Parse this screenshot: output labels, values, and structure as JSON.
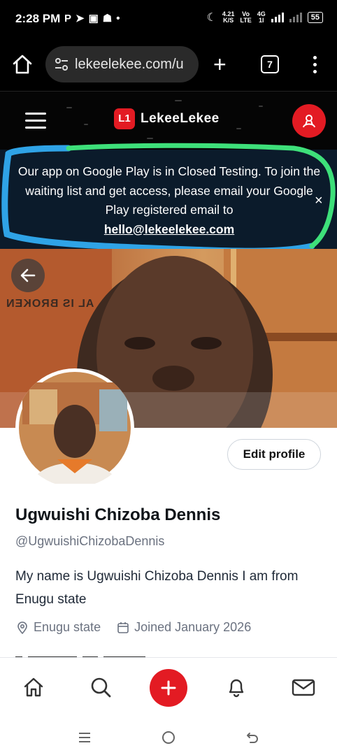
{
  "status_bar": {
    "time": "2:28 PM",
    "left_icons": [
      "p-icon",
      "send-icon",
      "app-icon",
      "snapchat-icon",
      "dot-icon"
    ],
    "speed_value": "4.21",
    "speed_unit": "K/S",
    "volte_top": "Vo",
    "volte_bottom": "LTE",
    "network_top": "4G",
    "network_bottom": "1l",
    "battery": "55"
  },
  "browser": {
    "url": "lekeelekee.com/u",
    "tab_count": "7"
  },
  "site_header": {
    "logo_mark": "L1",
    "logo_text": "LekeeLekee",
    "brand_color": "#e31b23"
  },
  "banner": {
    "message": "Our app on Google Play is in Closed Testing. To join the waiting list and get access, please email your Google Play registered email to",
    "email": "hello@lekeelekee.com",
    "close": "×"
  },
  "cover": {
    "background_text": "AL IS BROKEN"
  },
  "profile": {
    "edit_button": "Edit profile",
    "name": "Ugwuishi Chizoba Dennis",
    "handle": "@UgwuishiChizobaDennis",
    "bio": "My name is Ugwuishi Chizoba Dennis I am from Enugu state",
    "location": "Enugu state",
    "joined": "Joined January 2026"
  },
  "bottom_nav": {
    "items": [
      "home-icon",
      "search-icon",
      "add-icon",
      "bell-icon",
      "mail-icon"
    ]
  },
  "system_nav": {
    "items": [
      "recents-icon",
      "home-circle-icon",
      "back-icon"
    ]
  }
}
